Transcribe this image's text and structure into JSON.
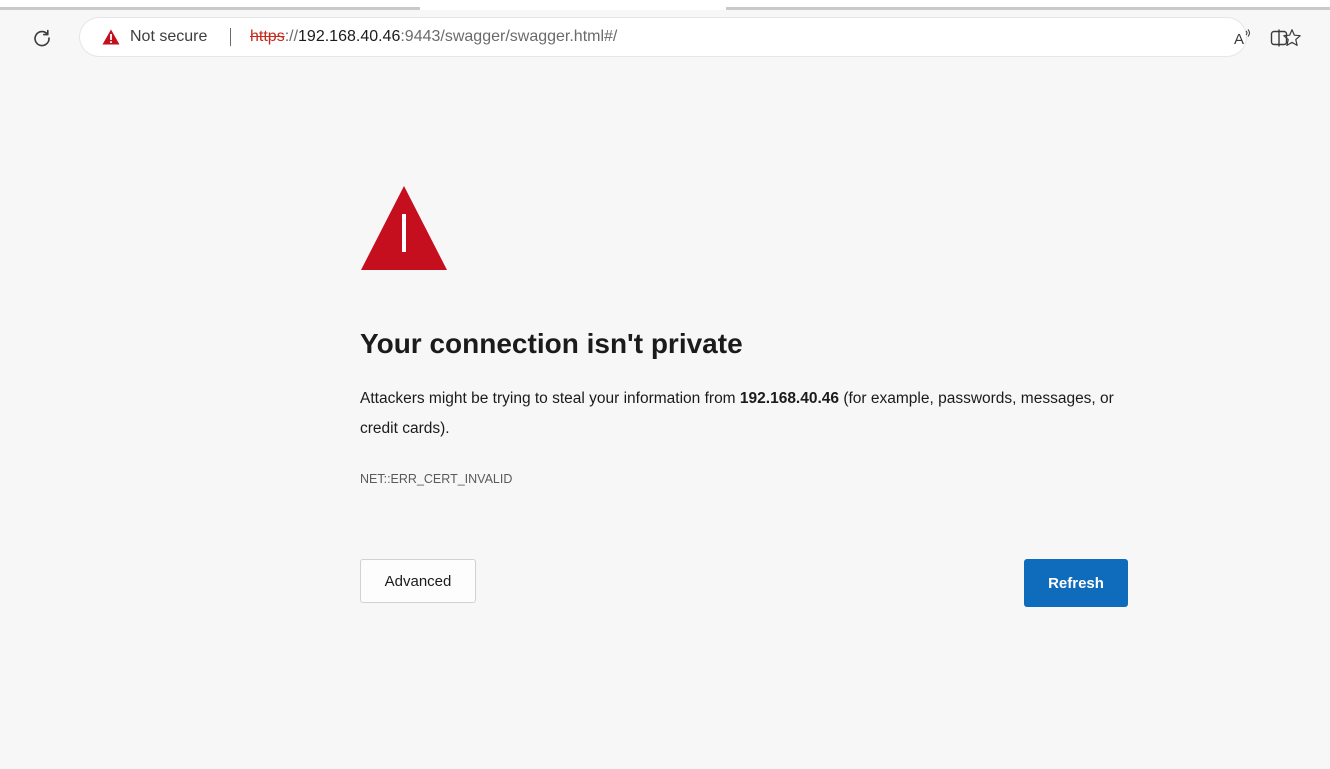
{
  "browser": {
    "address_bar": {
      "security_label": "Not secure",
      "url_scheme": "https",
      "url_after_scheme": "://",
      "url_host": "192.168.40.46",
      "url_rest": ":9443/swagger/swagger.html#/"
    },
    "icons": {
      "reload": "reload-icon",
      "security_warning": "warning-icon",
      "read_aloud": "read-aloud-icon",
      "favorite": "star-icon",
      "split_screen": "split-screen-icon"
    },
    "read_aloud_text": "A"
  },
  "error_page": {
    "heading": "Your connection isn't private",
    "description_before": "Attackers might be trying to steal your information from ",
    "description_host": "192.168.40.46",
    "description_after": " (for example, passwords, messages, or credit cards).",
    "error_code": "NET::ERR_CERT_INVALID",
    "advanced_button": "Advanced",
    "refresh_button": "Refresh"
  },
  "colors": {
    "warning_red": "#c50f1f",
    "scheme_red": "#c42b1c",
    "refresh_blue": "#0f6cbd",
    "page_background": "#f7f7f7"
  }
}
